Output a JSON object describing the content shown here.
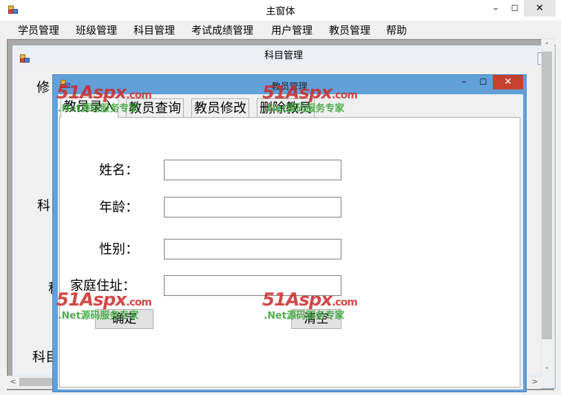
{
  "main_window": {
    "title": "主窗体",
    "minimize_glyph": "–",
    "maximize_glyph": "☐",
    "close_glyph": "✕"
  },
  "menu": {
    "items": [
      "学员管理",
      "班级管理",
      "科目管理",
      "考试成绩管理",
      "用户管理",
      "教员管理",
      "帮助"
    ]
  },
  "subject_window": {
    "title": "科目管理",
    "labels": [
      "修",
      "科",
      "科目"
    ]
  },
  "teacher_window": {
    "title": "教员管理",
    "minimize_glyph": "–",
    "maximize_glyph": "☐",
    "close_glyph": "✕",
    "tabs": [
      "教员录入",
      "教员查询",
      "教员修改",
      "删除教员"
    ],
    "active_tab": "教员录入",
    "form": {
      "name_label": "姓名：",
      "age_label": "年龄：",
      "gender_label": "性别：",
      "address_label": "家庭住址：",
      "name_value": "",
      "age_value": "",
      "gender_value": "",
      "address_value": ""
    },
    "confirm_label": "确定",
    "clear_label": "清空"
  },
  "scrollbars": {
    "up_glyph": "˄",
    "down_glyph": "˅",
    "left_glyph": "<",
    "right_glyph": ">"
  },
  "watermark": {
    "logo_text": "51Aspx",
    "logo_suffix": ".com",
    "tagline": ".Net源码服务专家"
  },
  "colors": {
    "dialog_frame": "#62a0da",
    "close_button": "#c7402e",
    "watermark_red": "#cc2a2a",
    "watermark_green": "#3aa63a"
  }
}
